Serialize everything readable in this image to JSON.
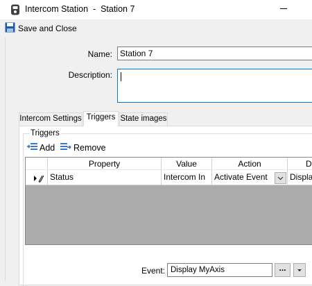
{
  "window": {
    "title": "Intercom Station  -  Station 7"
  },
  "toolbar": {
    "save_close_label": "Save and Close"
  },
  "form": {
    "name_label": "Name:",
    "name_value": "Station 7",
    "description_label": "Description:",
    "description_value": ""
  },
  "tabs": [
    {
      "label": "Intercom Settings",
      "active": false
    },
    {
      "label": "Triggers",
      "active": true
    },
    {
      "label": "State images",
      "active": false
    }
  ],
  "triggers": {
    "group_label": "Triggers",
    "add_label": "Add",
    "remove_label": "Remove",
    "columns": [
      "Property",
      "Value",
      "Action",
      "De"
    ],
    "rows": [
      {
        "property": "Status",
        "value": "Intercom In",
        "action": "Activate Event",
        "description": "Displa"
      }
    ],
    "event_label": "Event:",
    "event_value": "Display MyAxis",
    "ellipsis_label": "..."
  },
  "colors": {
    "focus_border": "#0078d7",
    "grid_background": "#ababab",
    "window_background": "#f0f0f0"
  },
  "icons": [
    "intercom-station-icon",
    "save-icon",
    "add-icon",
    "remove-icon",
    "edit-row-icon",
    "chevron-down-icon"
  ]
}
